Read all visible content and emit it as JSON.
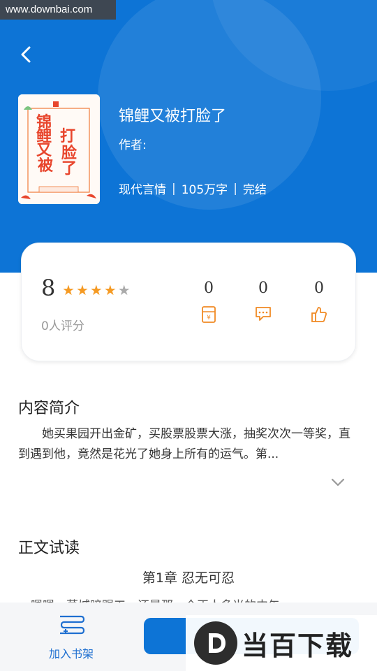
{
  "watermark_top": "www.downbai.com",
  "book": {
    "title": "锦鲤又被打脸了",
    "author_label": "作者:",
    "genre": "现代言情",
    "sep": "|",
    "word_count": "105万字",
    "status": "完结",
    "cover_title_chars": [
      "锦",
      "鲤",
      "又",
      "被",
      "打",
      "脸",
      "了"
    ]
  },
  "rating": {
    "score": "8",
    "stars_filled": 4,
    "stars_total": 5,
    "raters": "0人评分",
    "stats": [
      {
        "value": "0",
        "icon": "ticket-icon"
      },
      {
        "value": "0",
        "icon": "comment-icon"
      },
      {
        "value": "0",
        "icon": "thumbs-up-icon"
      }
    ]
  },
  "intro": {
    "heading": "内容简介",
    "text": "她买果园开出金矿，买股票股票大涨，抽奖次次一等奖，直到遇到他，竟然是花光了她身上所有的运气。第..."
  },
  "trial": {
    "heading": "正文试读",
    "chapter": "第1章 忍无可忍",
    "peek": "嗯嗯，莫城暗赐工，还是那一个正人多当的中午"
  },
  "bottom": {
    "shelf_label": "加入书架"
  },
  "logo_watermark": "当百下载",
  "colors": {
    "primary": "#0d74d6",
    "star": "#f59a23",
    "accent_orange": "#f08a24"
  }
}
